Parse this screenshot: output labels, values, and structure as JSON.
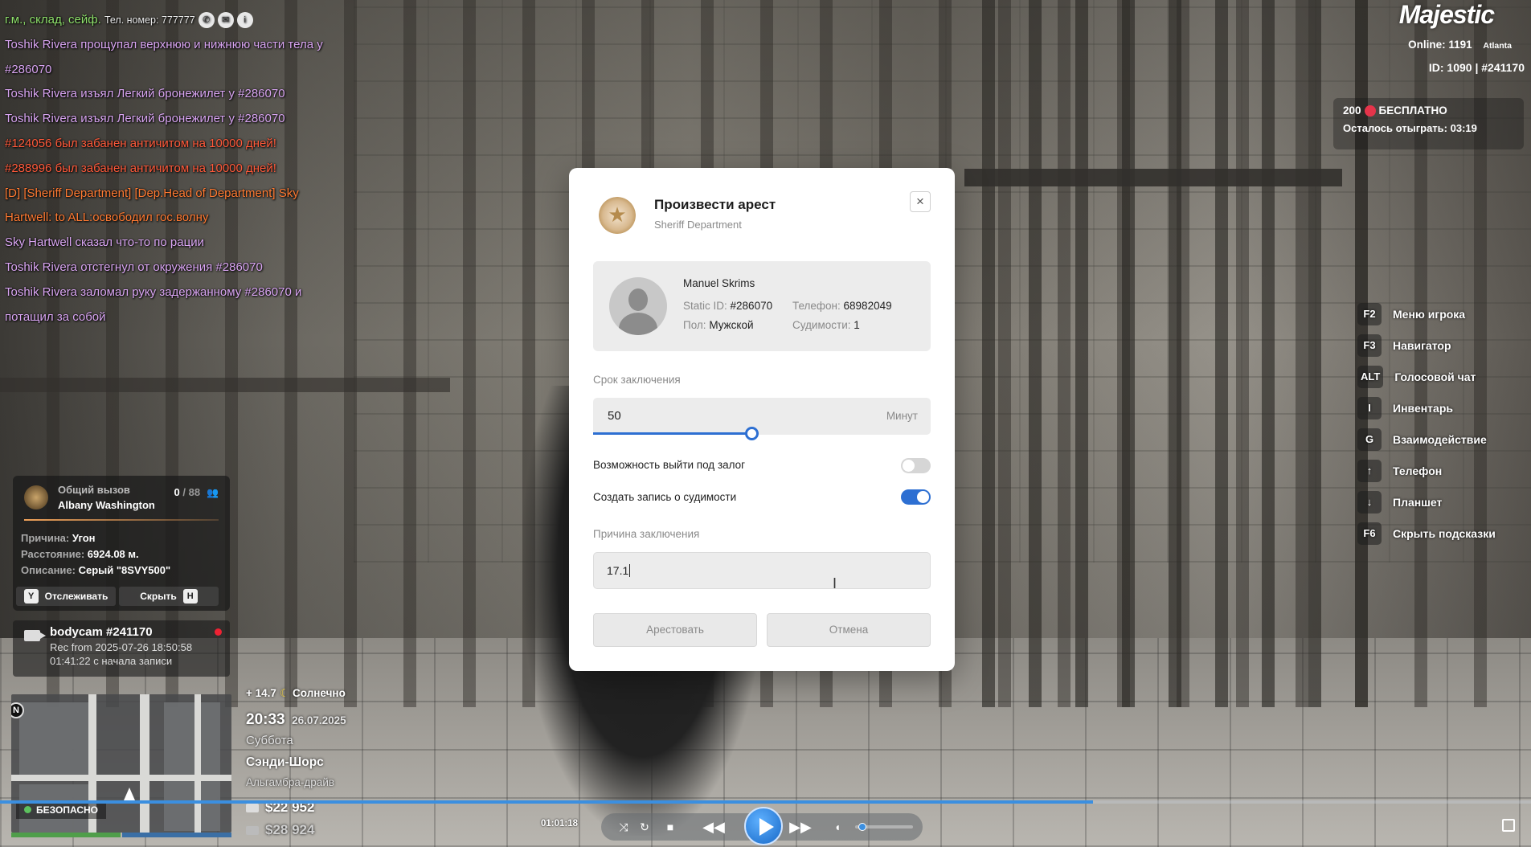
{
  "chat": {
    "lines": [
      {
        "text": "г.м., склад, сейф.",
        "color": "green"
      },
      {
        "text": "Toshik Rivera прощупал верхнюю и нижнюю части тела у",
        "color": "purple"
      },
      {
        "text": "#286070",
        "color": "purple"
      },
      {
        "text": "Toshik Rivera изъял Легкий бронежилет у #286070",
        "color": "purple"
      },
      {
        "text": "Toshik Rivera изъял Легкий бронежилет у #286070",
        "color": "purple"
      },
      {
        "text": "#124056 был забанен античитом на 10000 дней!",
        "color": "red"
      },
      {
        "text": "#288996 был забанен античитом на 10000 дней!",
        "color": "red"
      },
      {
        "text": "[D] [Sheriff Department] [Dep.Head of Department] Sky",
        "color": "orange"
      },
      {
        "text": "Hartwell: to ALL:освободил гос.волну",
        "color": "orange"
      },
      {
        "text": "Sky Hartwell сказал что-то по рации",
        "color": "purple"
      },
      {
        "text": "Toshik Rivera отстегнул от окружения #286070",
        "color": "purple"
      },
      {
        "text": "Toshik Rivera заломал руку задержанному #286070 и",
        "color": "purple"
      },
      {
        "text": "потащил за собой",
        "color": "purple"
      }
    ],
    "phone_meta": "Тел. номер: 777777"
  },
  "hud_top": {
    "brand": "Majestic",
    "online_label": "Online:",
    "online_value": "1191",
    "server": "Atlanta",
    "id_line": "ID: 1090 | #241170",
    "bonus_amount": "200",
    "bonus_free": "БЕСПЛАТНО",
    "bonus_remaining_label": "Осталось отыграть:",
    "bonus_remaining_time": "03:19"
  },
  "hints": [
    {
      "key": "F2",
      "label": "Меню игрока"
    },
    {
      "key": "F3",
      "label": "Навигатор"
    },
    {
      "key": "ALT",
      "label": "Голосовой чат"
    },
    {
      "key": "I",
      "label": "Инвентарь"
    },
    {
      "key": "G",
      "label": "Взаимодействие"
    },
    {
      "key": "↑",
      "label": "Телефон"
    },
    {
      "key": "↓",
      "label": "Планшет"
    },
    {
      "key": "F6",
      "label": "Скрыть подсказки"
    }
  ],
  "dispatch": {
    "title": "Общий вызов",
    "caller": "Albany Washington",
    "count_current": "0",
    "count_total": "/ 88",
    "reason_label": "Причина:",
    "reason_value": "Угон",
    "distance_label": "Расстояние:",
    "distance_value": "6924.08 м.",
    "desc_label": "Описание:",
    "desc_value": "Серый \"8SVY500\"",
    "track_key": "Y",
    "track_label": "Отслеживать",
    "hide_label": "Скрыть",
    "hide_key": "H"
  },
  "bodycam": {
    "title": "bodycam #241170",
    "rec": "Rec from 2025-07-26 18:50:58",
    "elapsed": "01:41:22 с начала записи"
  },
  "minimap": {
    "north": "N",
    "safe_label": "БЕЗОПАСНО"
  },
  "world": {
    "temp": "+ 14.7",
    "weather": "Солнечно",
    "time": "20:33",
    "date": "26.07.2025",
    "day": "Суббота",
    "area": "Сэнди-Шорс",
    "street": "Альгамбра-драйв",
    "cash": "$22 952",
    "bank": "$28 924"
  },
  "player": {
    "timecode": "01:01:18",
    "progress": 0.714,
    "volume": 0.1
  },
  "modal": {
    "title": "Произвести арест",
    "subtitle": "Sheriff Department",
    "close": "×",
    "suspect_name": "Manuel Skrims",
    "static_label": "Static ID:",
    "static_value": "#286070",
    "phone_label": "Телефон:",
    "phone_value": "68982049",
    "sex_label": "Пол:",
    "sex_value": "Мужской",
    "convictions_label": "Судимости:",
    "convictions_value": "1",
    "term_label": "Срок заключения",
    "term_value": "50",
    "term_unit": "Минут",
    "term_slider_fraction": 0.47,
    "bail_label": "Возможность выйти под залог",
    "bail_on": false,
    "record_label": "Создать запись о судимости",
    "record_on": true,
    "reason_label": "Причина заключения",
    "reason_value": "17.1",
    "arrest_button": "Арестовать",
    "cancel_button": "Отмена"
  },
  "colors": {
    "accent": "#2d6fd2",
    "chat_green": "#8ee06b",
    "chat_purple": "#d9a5f2",
    "chat_red": "#ff5a3b",
    "chat_orange": "#ff7a32"
  }
}
